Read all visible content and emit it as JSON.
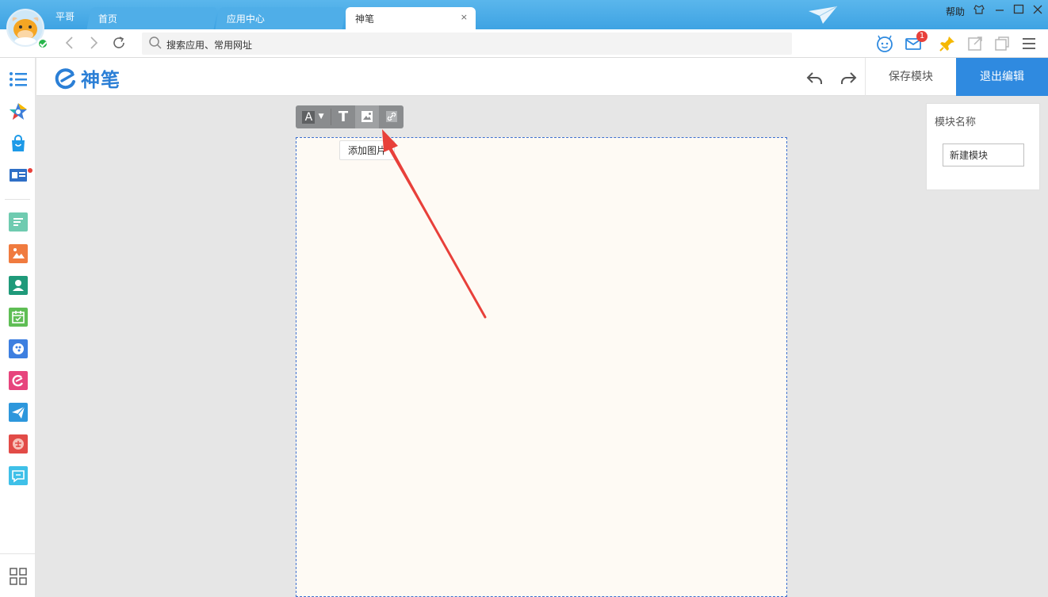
{
  "titlebar": {
    "user_name": "平哥",
    "tabs": [
      {
        "label": "首页",
        "active": false
      },
      {
        "label": "应用中心",
        "active": false
      },
      {
        "label": "神笔",
        "active": true
      }
    ],
    "tab_close": "×",
    "help_label": "帮助"
  },
  "addressbar": {
    "placeholder": "搜索应用、常用网址",
    "mail_badge": "1"
  },
  "app": {
    "logo_text": "神笔",
    "save_label": "保存模块",
    "exit_label": "退出编辑"
  },
  "editor": {
    "tool_font": "A",
    "tool_text": "T",
    "tooltip": "添加图片"
  },
  "panel": {
    "title": "模块名称",
    "module_name_value": "新建模块"
  },
  "colors": {
    "accent": "#2f8ae0",
    "titlebar": "#3ea3e3",
    "canvas_bg": "#fefaf4",
    "annotation_arrow": "#e8403a"
  }
}
